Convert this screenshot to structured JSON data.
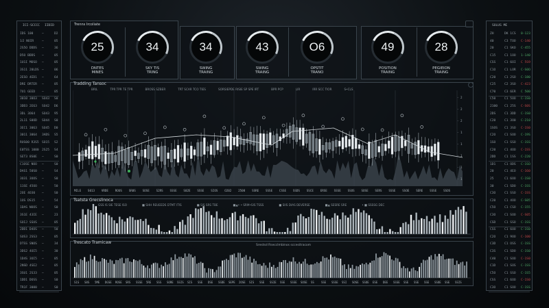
{
  "left_table": {
    "header": [
      "ICI·SCCCC",
      "IIDID"
    ],
    "rows": [
      [
        "IDS 100",
        "—",
        "D2"
      ],
      [
        "1⁄2 NOIR",
        "—",
        "05"
      ],
      [
        "2S5O DDDS",
        "—",
        "36"
      ],
      [
        "D5O BDDS",
        "—",
        "05"
      ],
      [
        "1U1I MOSO",
        "—",
        "05"
      ],
      [
        "3S11 20LDS",
        "—",
        "06"
      ],
      [
        "2ESO 4ED1",
        "—",
        "64"
      ],
      [
        "DRE DRTER",
        "—",
        "05"
      ],
      [
        "7U1 GEED",
        "—",
        "05"
      ],
      [
        "3010 30O3",
        "SO43",
        "S0"
      ],
      [
        "3DD3 2E63",
        "SO42",
        "D6"
      ],
      [
        "3DL 3O64",
        "SO43",
        "95"
      ],
      [
        "2L11 S0OD",
        "SO44",
        "S0"
      ],
      [
        "3EC1 3063",
        "SO45",
        "D0"
      ],
      [
        "3011 3064",
        "3ADS",
        "S5"
      ],
      [
        "RUS00 R3S5",
        "SO15",
        "S2"
      ],
      [
        "E0TSS 1000",
        "2S25",
        "S4"
      ],
      [
        "SET3 8S0E",
        "—",
        "S0"
      ],
      [
        "C1OSE NOO",
        "—",
        "S0"
      ],
      [
        "DAS1 50S0",
        "—",
        "S4"
      ],
      [
        "3O31 3OOS",
        "—",
        "S0"
      ],
      [
        "11SE 45OO",
        "—",
        "50"
      ],
      [
        "2OE 4O30",
        "—",
        "S0"
      ],
      [
        "1OS DS15",
        "—",
        "54"
      ],
      [
        "1DAS NOOS",
        "—",
        "S0"
      ],
      [
        "3S1E 43IE",
        "—",
        "23"
      ],
      [
        "SOIJ SSUS",
        "—",
        "05"
      ],
      [
        "2DD1 D4OS",
        "—",
        "50"
      ],
      [
        "SUS3 2SS3",
        "—",
        "05"
      ],
      [
        "DTSS SNOS",
        "—",
        "34"
      ],
      [
        "3DS2 4OI5",
        "—",
        "30"
      ],
      [
        "1D4S 3OI5",
        "—",
        "05"
      ],
      [
        "2NSD 4SE2",
        "—",
        "05"
      ],
      [
        "3SU1 2S33",
        "—",
        "05"
      ],
      [
        "1DD1 DOSS",
        "—",
        "S0"
      ],
      [
        "TR1F 3000",
        "—",
        "S0"
      ]
    ]
  },
  "right_table": {
    "header": [
      "SOLUS ME"
    ],
    "rows": [
      [
        "ZH",
        "DK 1CS",
        "0-123"
      ],
      [
        "40",
        "C3 TOO",
        "C-140"
      ],
      [
        "20",
        "C1 SKO",
        "C-455"
      ],
      [
        "C15",
        "C1 1OO",
        "1-140"
      ],
      [
        "CSS",
        "C1 6OI",
        "C 5S9"
      ],
      [
        "C1O",
        "C1 LOR",
        "C-S0O"
      ],
      [
        "C20",
        "C1 2SO",
        "C-180"
      ],
      [
        "C25",
        "C2 3SO",
        "C-423"
      ],
      [
        "C70",
        "C3 6ER",
        "C 500"
      ],
      [
        "C50",
        "C1 5OO",
        "C-1S0"
      ],
      [
        "2100",
        "C1 25S",
        "C-S0S"
      ],
      [
        "2DS",
        "C1 3DD",
        "C-1S0"
      ],
      [
        "C20",
        "C1 3O0",
        "C-210"
      ],
      [
        "1SOS",
        "C1 3SO",
        "C-1S0"
      ],
      [
        "C2O",
        "C1 SOO",
        "C-19S"
      ],
      [
        "1SO",
        "C1 SSO",
        "C-1SS"
      ],
      [
        "C20",
        "C1 4OO",
        "C-1SS"
      ],
      [
        "2DD",
        "C1 1SS",
        "C-220"
      ],
      [
        "1D1",
        "C1 ODS",
        "C-1SO"
      ],
      [
        "20",
        "C1 4EO",
        "C-160"
      ],
      [
        "25",
        "C1 6OO",
        "C-1S0"
      ],
      [
        "30",
        "C1 SDO",
        "C-1SS"
      ],
      [
        "C3O",
        "C1 SSO",
        "C-1SS"
      ],
      [
        "C20",
        "C1 4OO",
        "C-S05"
      ],
      [
        "C5O",
        "C1 CSO",
        "C-155"
      ],
      [
        "C3O",
        "C1 SOO",
        "C-S05"
      ],
      [
        "CSD",
        "C1 SSO",
        "C-1SS"
      ],
      [
        "CSS",
        "C1 6OO",
        "C-1S0"
      ],
      [
        "C2O",
        "C1 9OO",
        "C-100"
      ],
      [
        "C3D",
        "C1 OSS",
        "C-1SS"
      ],
      [
        "C3S",
        "C1 SDO",
        "C-1S0"
      ],
      [
        "C40",
        "C1 SOO",
        "C-1S0"
      ],
      [
        "C1D",
        "C1 SOS",
        "C-1SS"
      ],
      [
        "C5O",
        "C1 SSO",
        "C-1S5"
      ],
      [
        "CSS",
        "C1 6OO",
        "C-1S0"
      ],
      [
        "C3O",
        "C1 SOO",
        "C-1SS"
      ]
    ]
  },
  "top": {
    "title": "Trenns Ircoliate",
    "gauges": [
      {
        "value": "25",
        "label": "DNTES\nMINES"
      },
      {
        "value": "34",
        "label": "SKY TIS\nTRING"
      },
      {
        "value": "34",
        "label": "SWING\nTRAING"
      },
      {
        "value": "43",
        "label": "SWING\nTRAING"
      },
      {
        "value": "O6",
        "label": "OPSTIT\nTRANO"
      },
      {
        "value": "49",
        "label": "POSITION\nTRAING"
      },
      {
        "value": "28",
        "label": "PEGIEION\nTRAING"
      }
    ]
  },
  "main_chart": {
    "title": "Tradding Tansoc",
    "header_text": [
      "BRIL",
      "TPR  TPR  TE  TPR",
      "BROSS  SZBER",
      "TRT  SCAR  TCO  TIES",
      "SORSIEPDE  RISIE  SP SPE  IRT",
      "BPR  PCP",
      "LIR",
      "IRR  SCC  TIOR",
      "S•CLS"
    ],
    "x_labels": [
      "MILE",
      "S013",
      "VRDE",
      "ROUS",
      "SR0S",
      "SOSE",
      "S2RS",
      "SSSE",
      "S02E",
      "SSSE",
      "SIOS",
      "O202",
      "2508",
      "SSRE",
      "SSSE",
      "CSSE",
      "SSDS",
      "SSCE",
      "ERSE",
      "SSSE",
      "SSOS",
      "SOSE",
      "SERS",
      "SSSE",
      "SSOE",
      "SERE",
      "SSSE",
      "SSOS"
    ],
    "y_labels": [
      "- 2.40",
      "- 2.20",
      "- 2.00",
      "- 1.80",
      "- 1.60",
      "- 1.40",
      "- 1.20",
      "- 1.00"
    ]
  },
  "mid_chart": {
    "title": "Tsatsta Grecslinoca",
    "header_text": [
      "GSS IS  SIE  TESE  ISO",
      "■ SHH  REUEEDS  DTMT  ITIS",
      "■ SIS  SRS  TBE",
      "■▲•  •  SRM•SIS  TSSS",
      "■ SIIS  DIAS  DEVERSE",
      "■▲  SESRE  SRE",
      "• ■ SSSSG  DEC"
    ]
  },
  "bottom_chart": {
    "title": "Trescato Tramicaw",
    "subtitle": "Srestsd Rsecclmbinos sccesitracom",
    "x_labels": [
      "S1S",
      "S8S",
      "5ME",
      "DGSE",
      "ROSE",
      "SRS",
      "SSSE",
      "5RE",
      "SSS",
      "SORE",
      "SSIS",
      "SIS",
      "SSE",
      "DSE",
      "SSDE",
      "SEPE",
      "2OSE",
      "SIS",
      "SSE",
      "SSIE",
      "SSE",
      "SSSE",
      "SOSE",
      "SS",
      "SSE",
      "SSSE",
      "SSI",
      "SOSE",
      "SSOE",
      "ESE",
      "DEE",
      "SSSE",
      "SSE",
      "SSE",
      "SSE",
      "SSOE",
      "SSE",
      "SSIS"
    ]
  }
}
